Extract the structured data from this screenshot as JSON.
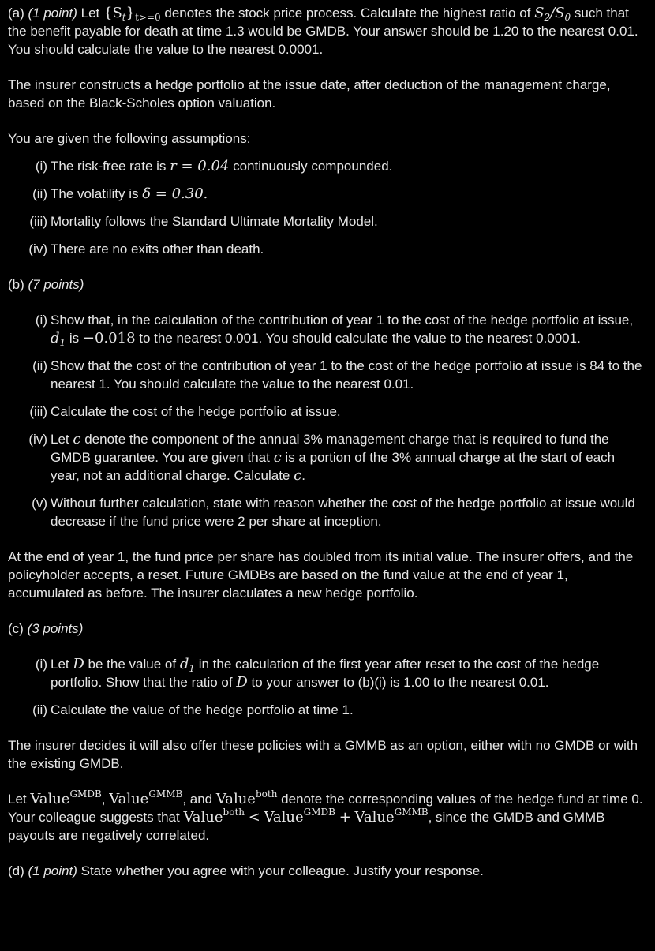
{
  "part_a": {
    "label": "(a)",
    "points": "(1 point)",
    "text1": "Let",
    "process_symbol": "{S",
    "process_sub": "t",
    "process_close": "}",
    "process_range": "t>=0",
    "text2": "denotes the stock price process. Calculate the highest ratio of",
    "ratio_s2": "S",
    "ratio_s2_sub": "2",
    "ratio_slash": "/",
    "ratio_s0": "S",
    "ratio_s0_sub": "0",
    "text3": "such that the benefit payable for death at time 1.3 would be GMDB. Your answer should be 1.20 to the nearest 0.01. You should calculate the value to the nearest 0.0001."
  },
  "intro_hedge": "The insurer constructs a hedge portfolio at the issue date, after deduction of the management charge, based on the Black-Scholes option valuation.",
  "assumptions_intro": "You are given the following assumptions:",
  "assumptions": [
    {
      "num": "(i)",
      "pre": "The risk-free rate is",
      "math": "r = 0.04",
      "post": "continuously compounded."
    },
    {
      "num": "(ii)",
      "pre": "The volatility is",
      "math": "δ = 0.30.",
      "post": ""
    },
    {
      "num": "(iii)",
      "pre": "Mortality follows the Standard Ultimate Mortality Model.",
      "math": "",
      "post": ""
    },
    {
      "num": "(iv)",
      "pre": "There are no exits other than death.",
      "math": "",
      "post": ""
    }
  ],
  "part_b": {
    "label": "(b)",
    "points": "(7 points)",
    "items": {
      "i": {
        "num": "(i)",
        "pre": "Show that, in the calculation of the contribution of year 1 to the cost of the hedge portfolio at issue,",
        "d": "d",
        "d_sub": "1",
        "mid": "is",
        "val": "−0.018",
        "post": "to the nearest 0.001. You should calculate the value to the nearest 0.0001."
      },
      "ii": {
        "num": "(ii)",
        "text": "Show that the cost of the contribution of year 1 to the cost of the hedge portfolio at issue is 84 to the nearest 1. You should calculate the value to the nearest 0.01."
      },
      "iii": {
        "num": "(iii)",
        "text": "Calculate the cost of the hedge portfolio at issue."
      },
      "iv": {
        "num": "(iv)",
        "pre": "Let",
        "c": "c",
        "mid1": "denote the component of the annual 3% management charge that is required to fund the GMDB guarantee. You are given that",
        "mid2": "is a portion of the 3% annual charge at the start of each year, not an additional charge. Calculate",
        "end": "."
      },
      "v": {
        "num": "(v)",
        "text": "Without further calculation, state with reason whether the cost of the hedge portfolio at issue would decrease if the fund price were 2 per share at inception."
      }
    }
  },
  "reset_para": "At the end of year 1, the fund price per share has doubled from its initial value. The insurer offers, and the policyholder accepts, a reset. Future GMDBs are based on the fund value at the end of year 1, accumulated as before. The insurer claculates a new hedge portfolio.",
  "part_c": {
    "label": "(c)",
    "points": "(3 points)",
    "items": {
      "i": {
        "num": "(i)",
        "pre": "Let",
        "D": "D",
        "mid1": "be the value of",
        "d": "d",
        "d_sub": "1",
        "mid2": "in the calculation of the first year after reset to the cost of the hedge portfolio. Show that the ratio of",
        "mid3": "to your answer to (b)(i) is 1.00 to the nearest 0.01."
      },
      "ii": {
        "num": "(ii)",
        "text": "Calculate the value of the hedge portfolio at time 1."
      }
    }
  },
  "gmmb_para": "The insurer decides it will also offer these policies with a GMMB as an option, either with no GMDB or with the existing GMDB.",
  "values_para": {
    "pre": "Let",
    "value": "Value",
    "sup_gmdb": "GMDB",
    "sup_gmmb": "GMMB",
    "sup_both": "both",
    "comma": ",",
    "and": ", and",
    "mid": "denote the corresponding values of the hedge fund at time 0. Your colleague suggests that",
    "lt": "<",
    "plus": "+",
    "post": ", since the GMDB and GMMB payouts are negatively correlated."
  },
  "part_d": {
    "label": "(d)",
    "points": "(1 point)",
    "text": "State whether you agree with your colleague. Justify your response."
  }
}
